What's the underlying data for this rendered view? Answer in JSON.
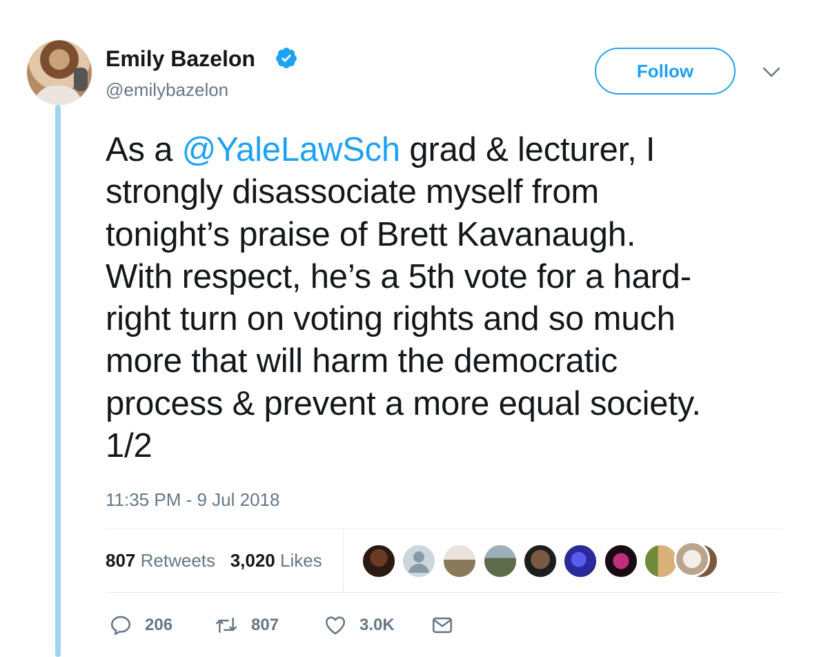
{
  "author": {
    "name": "Emily Bazelon",
    "handle": "@emilybazelon",
    "verified": true
  },
  "follow_button": {
    "label": "Follow"
  },
  "tweet": {
    "lines": [
      {
        "prefix": "As a ",
        "mention": "@YaleLawSch",
        "suffix": " grad & lecturer, I"
      },
      {
        "text": "strongly disassociate myself from"
      },
      {
        "text": "tonight’s praise of Brett Kavanaugh."
      },
      {
        "text": "With respect, he’s a 5th vote for a hard-"
      },
      {
        "text": "right turn on voting rights and so much"
      },
      {
        "text": "more that will harm the democratic"
      },
      {
        "text": "process & prevent a more equal society."
      },
      {
        "text": "1/2"
      }
    ],
    "timestamp": "11:35 PM - 9 Jul 2018"
  },
  "stats": {
    "retweets_count": "807",
    "retweets_label": "Retweets",
    "likes_count": "3,020",
    "likes_label": "Likes"
  },
  "actions": {
    "replies": "206",
    "retweets": "807",
    "likes": "3.0K"
  },
  "colors": {
    "accent": "#1da1f2",
    "thread_line": "#9fd3f2",
    "secondary_text": "#657786"
  },
  "liker_avatars": [
    "liker-avatar-1",
    "liker-avatar-2",
    "liker-avatar-3",
    "liker-avatar-4",
    "liker-avatar-5",
    "liker-avatar-6",
    "liker-avatar-7",
    "liker-avatar-8",
    "liker-avatar-9",
    "liker-avatar-10"
  ]
}
